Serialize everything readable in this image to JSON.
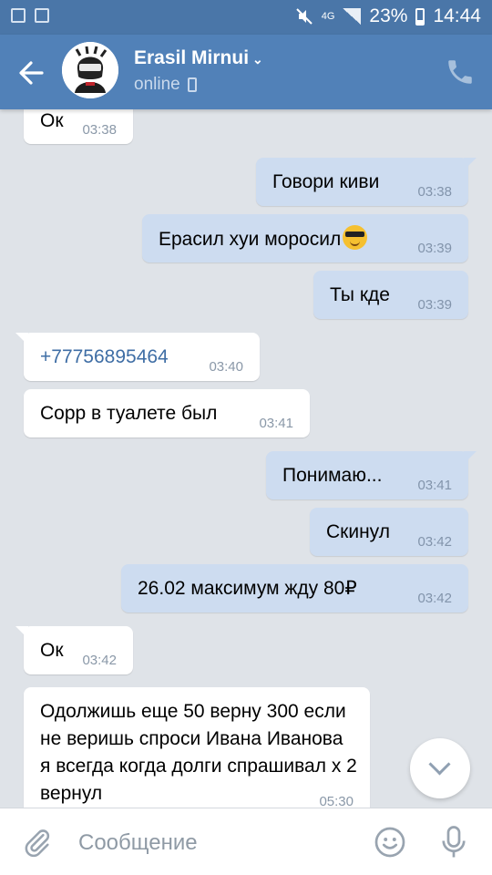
{
  "status_bar": {
    "network": "4G",
    "battery": "23%",
    "time": "14:44",
    "icons": [
      "image-icon",
      "recycle-icon",
      "mute-icon",
      "signal-icon",
      "battery-icon"
    ]
  },
  "header": {
    "name": "Erasil Mirnui",
    "status": "online",
    "back_icon": "arrow-left-icon",
    "call_icon": "phone-icon"
  },
  "messages": [
    {
      "dir": "in",
      "text": "Ок",
      "time": "03:38"
    },
    {
      "dir": "out",
      "text": "Говори киви",
      "time": "03:38"
    },
    {
      "dir": "out",
      "text": "Ерасил хуи моросил",
      "emoji": "sunglasses-emoji",
      "time": "03:39"
    },
    {
      "dir": "out",
      "text": "Ты кде",
      "time": "03:39"
    },
    {
      "dir": "in",
      "text": "+77756895464",
      "link": true,
      "time": "03:40"
    },
    {
      "dir": "in",
      "text": "Сорр в туалете был",
      "time": "03:41"
    },
    {
      "dir": "out",
      "text": "Понимаю...",
      "time": "03:41"
    },
    {
      "dir": "out",
      "text": "Скинул",
      "time": "03:42"
    },
    {
      "dir": "out",
      "text": "26.02 максимум жду 80₽",
      "time": "03:42"
    },
    {
      "dir": "in",
      "text": "Ок",
      "time": "03:42"
    },
    {
      "dir": "in",
      "text": "Одолжишь еще 50 верну 300 если не веришь спроси Ивана Иванова я всегда когда долги спрашивал х 2 вернул",
      "time": "05:30"
    }
  ],
  "composer": {
    "placeholder": "Сообщение"
  },
  "colors": {
    "header": "#5181b8",
    "status_bar": "#4a76a8",
    "background": "#dfe3e8",
    "incoming_bubble": "#ffffff",
    "outgoing_bubble": "#cddcf0",
    "link": "#3f6ea5"
  }
}
